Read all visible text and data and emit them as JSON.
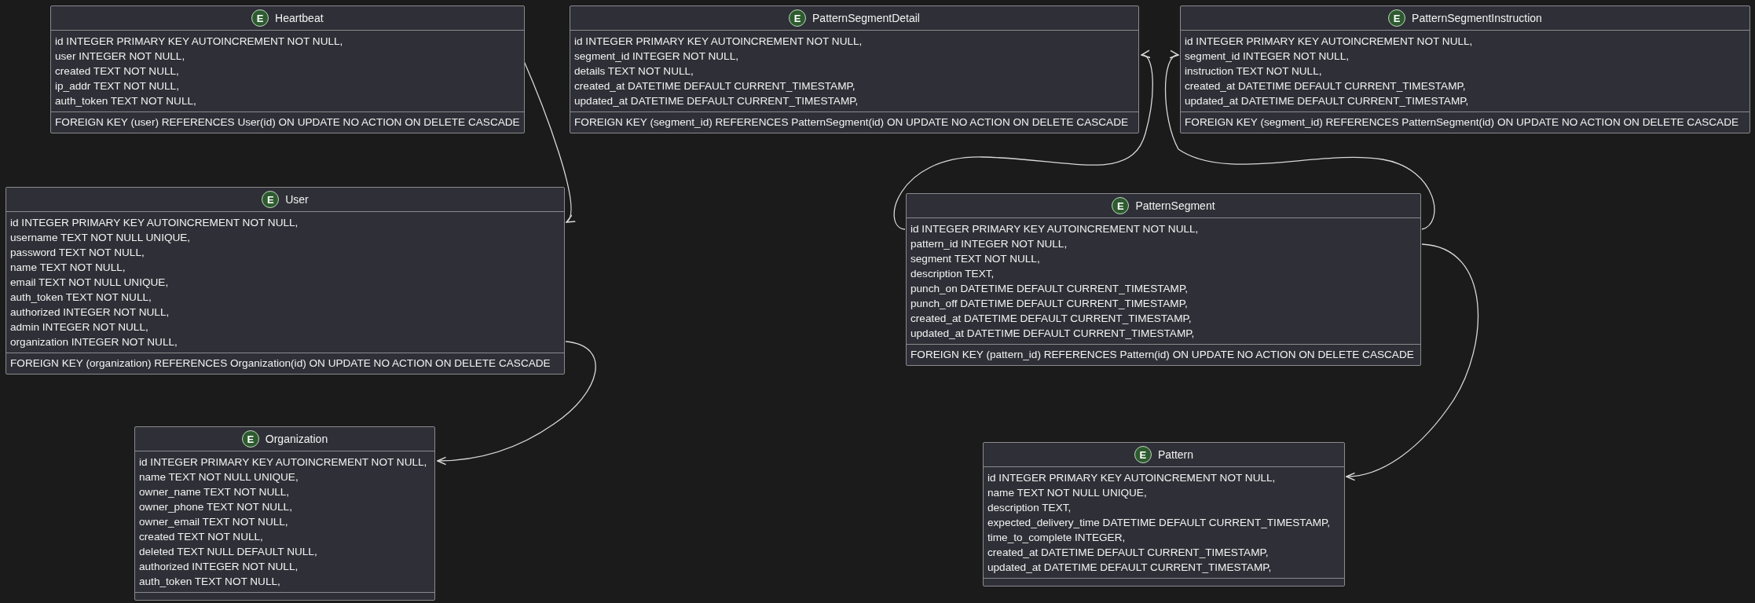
{
  "entities": [
    {
      "badge": "E",
      "name": "Heartbeat",
      "fields": [
        "id INTEGER PRIMARY KEY AUTOINCREMENT NOT NULL,",
        "user INTEGER NOT NULL,",
        "created TEXT NOT NULL,",
        "ip_addr TEXT NOT NULL,",
        "auth_token TEXT NOT NULL,"
      ],
      "foreign_keys": [
        "FOREIGN KEY (user) REFERENCES User(id) ON UPDATE NO ACTION ON DELETE CASCADE"
      ]
    },
    {
      "badge": "E",
      "name": "PatternSegmentDetail",
      "fields": [
        "id INTEGER PRIMARY KEY AUTOINCREMENT NOT NULL,",
        "segment_id INTEGER NOT NULL,",
        "details TEXT NOT NULL,",
        "created_at DATETIME DEFAULT CURRENT_TIMESTAMP,",
        "updated_at DATETIME DEFAULT CURRENT_TIMESTAMP,"
      ],
      "foreign_keys": [
        "FOREIGN KEY (segment_id) REFERENCES PatternSegment(id) ON UPDATE NO ACTION ON DELETE CASCADE"
      ]
    },
    {
      "badge": "E",
      "name": "PatternSegmentInstruction",
      "fields": [
        "id INTEGER PRIMARY KEY AUTOINCREMENT NOT NULL,",
        "segment_id INTEGER NOT NULL,",
        "instruction TEXT NOT NULL,",
        "created_at DATETIME DEFAULT CURRENT_TIMESTAMP,",
        "updated_at DATETIME DEFAULT CURRENT_TIMESTAMP,"
      ],
      "foreign_keys": [
        "FOREIGN KEY (segment_id) REFERENCES PatternSegment(id) ON UPDATE NO ACTION ON DELETE CASCADE"
      ]
    },
    {
      "badge": "E",
      "name": "User",
      "fields": [
        "id INTEGER PRIMARY KEY AUTOINCREMENT NOT NULL,",
        "username TEXT NOT NULL UNIQUE,",
        "password TEXT NOT NULL,",
        "name TEXT NOT NULL,",
        "email TEXT NOT NULL UNIQUE,",
        "auth_token TEXT NOT NULL,",
        "authorized INTEGER NOT NULL,",
        "admin INTEGER NOT NULL,",
        "organization INTEGER NOT NULL,"
      ],
      "foreign_keys": [
        "FOREIGN KEY (organization) REFERENCES Organization(id) ON UPDATE NO ACTION ON DELETE CASCADE"
      ]
    },
    {
      "badge": "E",
      "name": "PatternSegment",
      "fields": [
        "id INTEGER PRIMARY KEY AUTOINCREMENT NOT NULL,",
        "pattern_id INTEGER NOT NULL,",
        "segment TEXT NOT NULL,",
        "description TEXT,",
        "punch_on DATETIME DEFAULT CURRENT_TIMESTAMP,",
        "punch_off DATETIME DEFAULT CURRENT_TIMESTAMP,",
        "created_at DATETIME DEFAULT CURRENT_TIMESTAMP,",
        "updated_at DATETIME DEFAULT CURRENT_TIMESTAMP,"
      ],
      "foreign_keys": [
        "FOREIGN KEY (pattern_id) REFERENCES Pattern(id) ON UPDATE NO ACTION ON DELETE CASCADE"
      ]
    },
    {
      "badge": "E",
      "name": "Organization",
      "fields": [
        "id INTEGER PRIMARY KEY AUTOINCREMENT NOT NULL,",
        "name TEXT NOT NULL UNIQUE,",
        "owner_name TEXT NOT NULL,",
        "owner_phone TEXT NOT NULL,",
        "owner_email TEXT NOT NULL,",
        "created TEXT NOT NULL,",
        "deleted TEXT NULL DEFAULT NULL,",
        "authorized INTEGER NOT NULL,",
        "auth_token TEXT NOT NULL,"
      ]
    },
    {
      "badge": "E",
      "name": "Pattern",
      "fields": [
        "id INTEGER PRIMARY KEY AUTOINCREMENT NOT NULL,",
        "name TEXT NOT NULL UNIQUE,",
        "description TEXT,",
        "expected_delivery_time DATETIME DEFAULT CURRENT_TIMESTAMP,",
        "time_to_complete INTEGER,",
        "created_at DATETIME DEFAULT CURRENT_TIMESTAMP,",
        "updated_at DATETIME DEFAULT CURRENT_TIMESTAMP,"
      ]
    }
  ]
}
